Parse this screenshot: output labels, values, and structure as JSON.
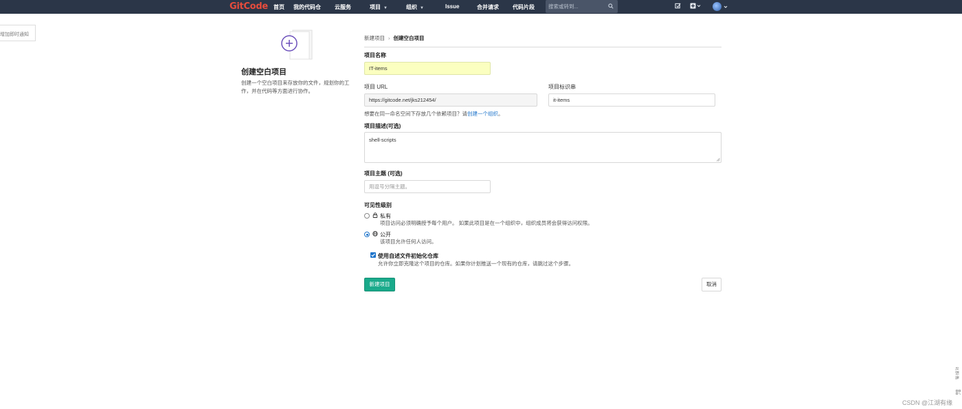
{
  "navbar": {
    "logo": "GitCode",
    "items": [
      {
        "label": "首页"
      },
      {
        "label": "我的代码仓"
      },
      {
        "label": "云服务"
      },
      {
        "label": "项目"
      },
      {
        "label": "组织"
      },
      {
        "label": "Issue"
      },
      {
        "label": "合并请求"
      },
      {
        "label": "代码片段"
      }
    ],
    "search_placeholder": "搜索或转到...",
    "icons": [
      "search-icon",
      "todo-icon",
      "plus-icon",
      "avatar"
    ]
  },
  "notice": {
    "text": "增加即时通知"
  },
  "intro": {
    "title": "创建空白项目",
    "description": "创建一个空白项目来存放你的文件，规划你的工作，并在代码等方面进行协作。"
  },
  "breadcrumb": {
    "parent": "新建项目",
    "current": "创建空白项目"
  },
  "form": {
    "name_label": "项目名称",
    "name_value": "IT-items",
    "url_label": "项目 URL",
    "url_value": "https://gitcode.net/jks212454/",
    "slug_label": "项目标识串",
    "slug_value": "it-items",
    "url_hint_prefix": "想要在同一命名空间下存放几个依赖项目？请",
    "url_hint_link": "创建一个组织",
    "url_hint_suffix": "。",
    "desc_label": "项目描述(可选)",
    "desc_value": "shell-scripts",
    "topic_label": "项目主题 (可选)",
    "topic_placeholder": "用逗号分隔主题。",
    "visibility_label": "可见性级别",
    "visibility_options": [
      {
        "title": "私有",
        "desc": "项目访问必须明确授予每个用户。 如果此项目是在一个组织中，组织成员将会获得访问权限。",
        "checked": false,
        "icon": "lock-icon"
      },
      {
        "title": "公开",
        "desc": "该项目允许任何人访问。",
        "checked": true,
        "icon": "globe-icon"
      }
    ],
    "readme_label": "使用自述文件初始化仓库",
    "readme_desc": "允许你立即克隆这个项目的仓库。如果你计划推送一个现有的仓库，请跳过这个步骤。",
    "readme_checked": true,
    "submit_label": "新建项目",
    "cancel_label": "取消"
  },
  "side_tools": {
    "text": "反馈建议"
  },
  "watermark": "CSDN @江湖有缘",
  "colors": {
    "navbar_bg": "#2b3648",
    "logo": "#e74c3c",
    "primary_button": "#1aaa8b",
    "link": "#1f75cb",
    "highlight_input": "#fbffc0",
    "illustration_accent": "#6b4fbb"
  }
}
